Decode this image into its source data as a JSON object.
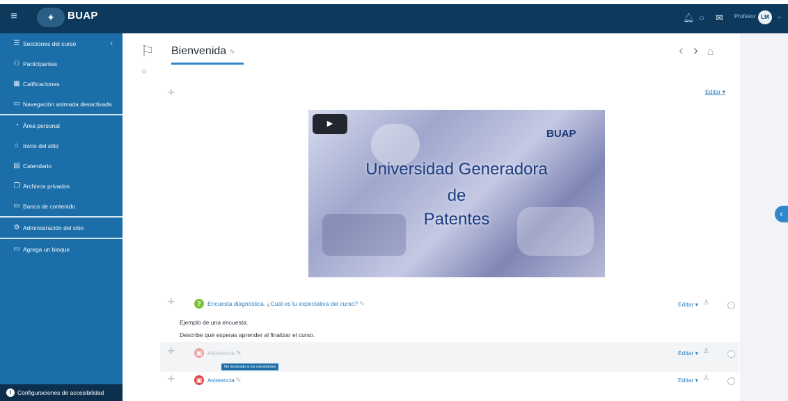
{
  "header": {
    "menu_icon": "hamburger-icon",
    "brand": "BUAP",
    "role": "Profesor",
    "avatar_initials": "LM",
    "icons": [
      "bell-icon",
      "chat-icon",
      "envelope-icon"
    ]
  },
  "sidebar": {
    "sections": [
      [
        {
          "label": "Secciones del curso",
          "icon": "list-icon",
          "chevron": "‹"
        },
        {
          "label": "Participantes",
          "icon": "users-icon"
        },
        {
          "label": "Calificaciones",
          "icon": "table-icon"
        },
        {
          "label": "Navegación animada desactivada",
          "icon": "square-icon"
        }
      ],
      [
        {
          "label": "Área personal",
          "icon": "dashboard-icon"
        },
        {
          "label": "Inicio del sitio",
          "icon": "home-icon"
        },
        {
          "label": "Calendario",
          "icon": "calendar-icon"
        },
        {
          "label": "Archivos privados",
          "icon": "files-icon"
        },
        {
          "label": "Banco de contenido",
          "icon": "box-icon"
        }
      ],
      [
        {
          "label": "Administración del sitio",
          "icon": "gear-icon"
        }
      ],
      [
        {
          "label": "Agrega un bloque",
          "icon": "square-icon"
        }
      ]
    ],
    "accessibility": "Configuraciones de accesibilidad"
  },
  "main": {
    "title": "Bienvenida",
    "edit_label": "Editar",
    "video": {
      "brand": "BUAP",
      "lines": [
        "Universidad Generadora",
        "de",
        "Patentes"
      ]
    },
    "activities": [
      {
        "name": "Encuesta diagnóstica. ¿Cuál es tu expectativa del curso?",
        "icon_color": "#7cc23a",
        "edit": "Editar"
      },
      {
        "name": "Asistencia",
        "icon_color": "#f2a3a3",
        "edit": "Editar",
        "badge": "No mostrado a los estudiantes"
      },
      {
        "name": "Asistencia",
        "icon_color": "#e04a4a",
        "edit": "Editar"
      }
    ],
    "description": [
      "Ejemplo de una encuesta.",
      "Describe qué esperas aprender al finalizar el curso."
    ]
  }
}
